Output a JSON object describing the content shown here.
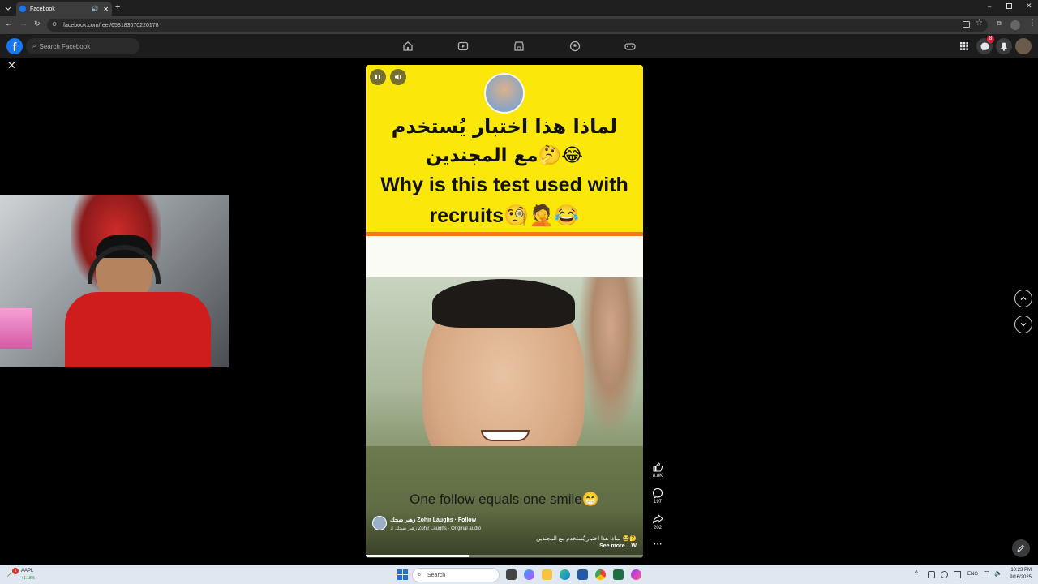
{
  "browser": {
    "tab_title": "Facebook",
    "url": "facebook.com/reel/658183670220178"
  },
  "facebook": {
    "search_placeholder": "Search Facebook",
    "notification_count": "8"
  },
  "reel": {
    "title_ar_line1": "لماذا هذا اختبار يُستخدم",
    "title_ar_line2": "مع المجندين🤔😂",
    "title_en_line1": "Why is this test used with",
    "title_en_line2": "recruits🧐🤦😂",
    "caption": "One follow equals one smile😁",
    "author": "زهير ضحك Zohir Laughs",
    "follow": "· Follow",
    "audio": "زهير ضحك Zohir Laughs · Original audio",
    "description": "لماذا هذا اختبار يُستخدم مع المجندين 😂🤔",
    "see_more": "See more ...W"
  },
  "actions": {
    "likes": "8.8K",
    "comments": "197",
    "shares": "202"
  },
  "taskbar": {
    "stock_symbol": "AAPL",
    "stock_change": "+1.18%",
    "stock_badge": "1",
    "search_label": "Search",
    "language": "ENG",
    "time": "10:23 PM",
    "date": "9/16/2025"
  },
  "colors": {
    "fb_blue": "#1877f2",
    "reel_yellow": "#fbe80a",
    "dark_bg": "#000000"
  }
}
